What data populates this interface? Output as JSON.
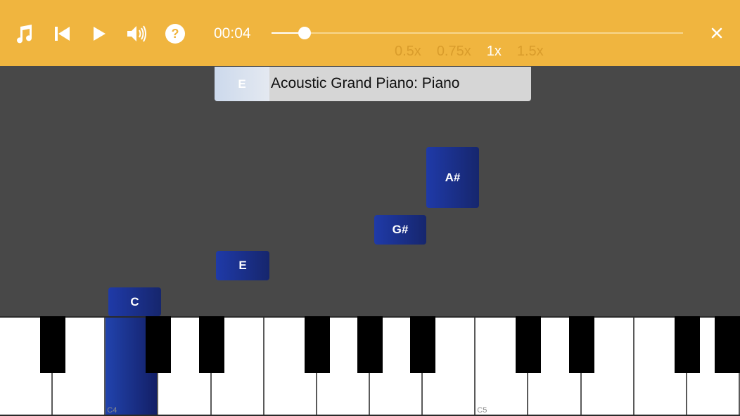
{
  "toolbar": {
    "icons": [
      "music-note-icon",
      "skip-back-icon",
      "play-icon",
      "volume-icon",
      "help-icon"
    ],
    "time": "00:04",
    "progress": 0.08,
    "speeds": [
      "0.5x",
      "0.75x",
      "1x",
      "1.5x"
    ],
    "selected_speed": "1x",
    "close_icon": "close-icon"
  },
  "instrument": {
    "note": "E",
    "name": "Acoustic Grand Piano: Piano"
  },
  "notes": [
    {
      "label": "C"
    },
    {
      "label": "E"
    },
    {
      "label": "G#"
    },
    {
      "label": "A#"
    }
  ],
  "keyboard": {
    "labels": [
      "C4",
      "C5"
    ],
    "pressed_key": "C4"
  },
  "colors": {
    "toolbar": "#f0b53f",
    "background": "#484848",
    "note_blue": "#1f3aa8"
  }
}
